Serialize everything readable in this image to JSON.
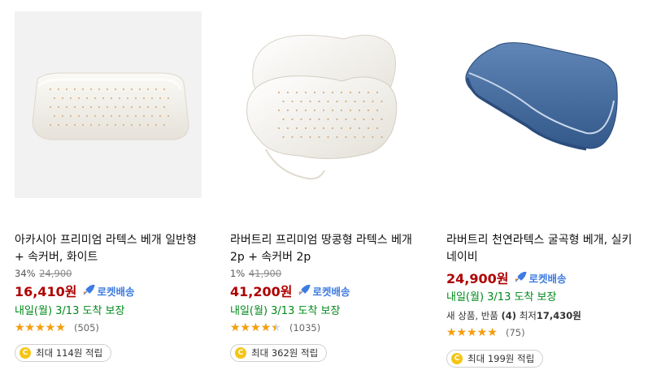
{
  "products": [
    {
      "title": "아카시아 프리미엄 라텍스 베개 일반형 + 속커버, 화이트",
      "discount_rate": "34%",
      "original_price": "24,900",
      "price": "16,410원",
      "rocket_label": "로켓배송",
      "arrival": "내일(월) 3/13 도착 보장",
      "rating": 4.5,
      "review_count": "(505)",
      "reward": "최대 114원 적립",
      "coin_symbol": "C"
    },
    {
      "title": "라버트리 프리미엄 땅콩형 라텍스 베개 2p + 속커버 2p",
      "discount_rate": "1%",
      "original_price": "41,900",
      "price": "41,200원",
      "rocket_label": "로켓배송",
      "arrival": "내일(월) 3/13 도착 보장",
      "rating": 4.0,
      "review_count": "(1035)",
      "reward": "최대 362원 적립",
      "coin_symbol": "C"
    },
    {
      "title": "라버트리 천연라텍스 굴곡형 베개, 실키네이비",
      "price": "24,900원",
      "rocket_label": "로켓배송",
      "arrival": "내일(월) 3/13 도착 보장",
      "extra_prefix": "새 상품, 반품 ",
      "extra_count": "(4)",
      "extra_min": " 최저",
      "extra_min_price": "17,430원",
      "rating": 4.5,
      "review_count": "(75)",
      "reward": "최대 199원 적립",
      "coin_symbol": "C"
    }
  ],
  "colors": {
    "price": "#ae0000",
    "rocket": "#3d7be0",
    "arrival": "#00891a",
    "star": "#f59e0b",
    "coin": "#f6c514"
  },
  "icons": {
    "rocket": "rocket-icon",
    "star": "star-icon",
    "coin": "coin-icon"
  }
}
